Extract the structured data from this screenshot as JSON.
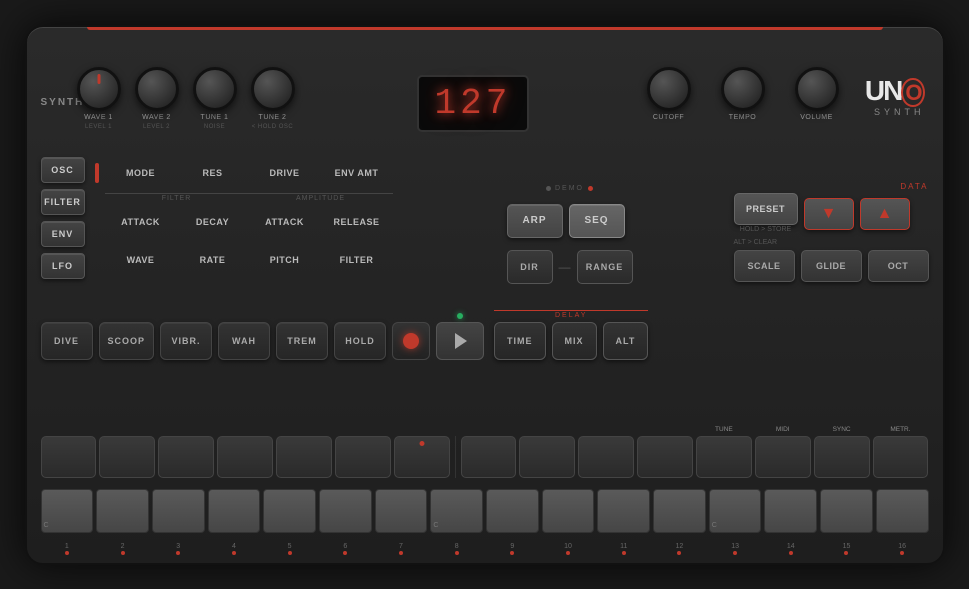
{
  "synth": {
    "title": "UNO SYNTH",
    "display_value": "127",
    "logo": {
      "text": "UNO",
      "subtitle": "SYNTH"
    }
  },
  "labels": {
    "synth": "SYNTH",
    "cutoff": "CUTOFF",
    "tempo": "TEMPO",
    "volume": "VOLUME",
    "data": "DATA",
    "delay": "DELAY",
    "demo": "DEMO"
  },
  "sidebar": {
    "buttons": [
      "OSC",
      "FILTER",
      "ENV",
      "LFO"
    ]
  },
  "knobs": {
    "left": [
      {
        "main": "WAVE 1",
        "sub": "LEVEL 1"
      },
      {
        "main": "WAVE 2",
        "sub": "LEVEL 2"
      },
      {
        "main": "TUNE 1",
        "sub": "NOISE"
      },
      {
        "main": "TUNE 2",
        "sub": "< HOLD OSC"
      }
    ],
    "right": [
      {
        "main": "CUTOFF",
        "sub": ""
      },
      {
        "main": "TEMPO",
        "sub": ""
      },
      {
        "main": "VOLUME",
        "sub": ""
      }
    ]
  },
  "controls": {
    "filter_row": {
      "items": [
        {
          "main": "MODE",
          "sub": ""
        },
        {
          "main": "RES",
          "sub": ""
        },
        {
          "main": "DRIVE",
          "sub": ""
        },
        {
          "main": "ENV AMT",
          "sub": ""
        }
      ]
    },
    "env_row": {
      "filter_label": "FILTER",
      "amplitude_label": "AMPLITUDE",
      "items": [
        {
          "main": "ATTACK",
          "sub": ""
        },
        {
          "main": "DECAY",
          "sub": ""
        },
        {
          "main": "ATTACK",
          "sub": ""
        },
        {
          "main": "RELEASE",
          "sub": ""
        }
      ]
    },
    "lfo_row": {
      "items": [
        {
          "main": "WAVE",
          "sub": ""
        },
        {
          "main": "RATE",
          "sub": ""
        },
        {
          "main": "PITCH",
          "sub": ""
        },
        {
          "main": "FILTER",
          "sub": ""
        }
      ]
    }
  },
  "arp_seq": {
    "demo_label": "DEMO",
    "arp_label": "ARP",
    "seq_label": "SEQ",
    "dir_label": "DIR",
    "range_label": "RANGE"
  },
  "right_panel": {
    "preset_label": "PRESET",
    "preset_sub": "HOLD > STORE",
    "data_label": "DATA",
    "alt_clear": "ALT > CLEAR",
    "scale_label": "SCALE",
    "glide_label": "GLIDE",
    "oct_label": "OCT"
  },
  "effects": {
    "buttons": [
      {
        "label": "DIVE",
        "top": ""
      },
      {
        "label": "SCOOP",
        "top": ""
      },
      {
        "label": "VIBR.",
        "top": ""
      },
      {
        "label": "WAH",
        "top": ""
      },
      {
        "label": "TREM",
        "top": ""
      },
      {
        "label": "HOLD",
        "top": ""
      }
    ],
    "delay_btns": [
      {
        "label": "TIME",
        "top": ""
      },
      {
        "label": "MIX",
        "top": ""
      },
      {
        "label": "ALT",
        "top": ""
      }
    ]
  },
  "step_keys": {
    "function_labels": [
      "TUNE",
      "MIDI",
      "SYNC",
      "METR."
    ],
    "steps": [
      1,
      2,
      3,
      4,
      5,
      6,
      7,
      8,
      9,
      10,
      11,
      12,
      13,
      14,
      15,
      16
    ],
    "notes": [
      "C",
      "",
      "",
      "",
      "",
      "",
      "",
      "C",
      "",
      "",
      "",
      "",
      "C",
      "",
      "",
      ""
    ]
  }
}
